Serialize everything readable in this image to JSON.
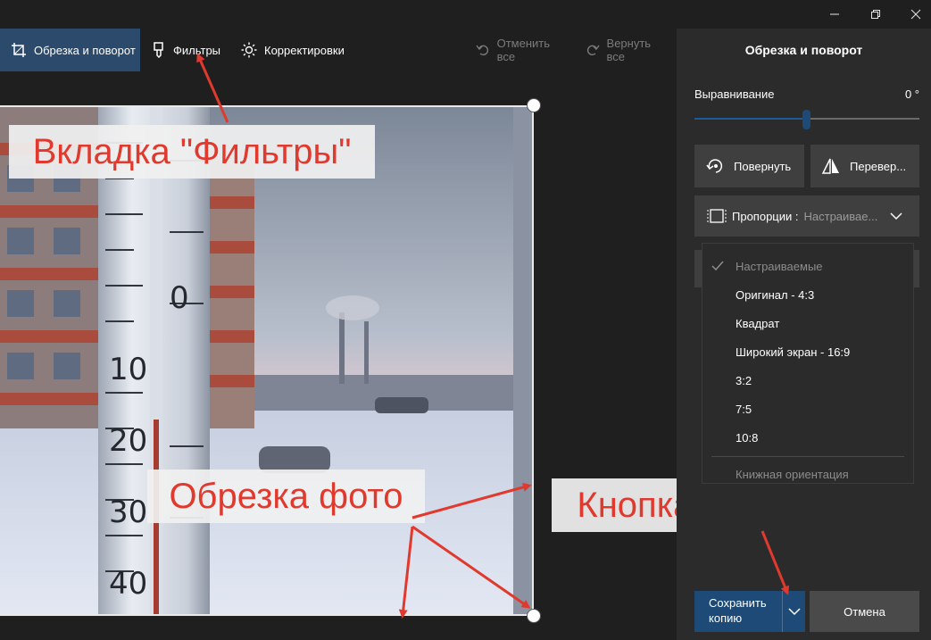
{
  "toolbar": {
    "crop_label": "Обрезка и поворот",
    "filters_label": "Фильтры",
    "adjust_label": "Корректировки",
    "undo_all_label": "Отменить все",
    "redo_all_label": "Вернуть все"
  },
  "window": {
    "minimize_icon": "minimize-icon",
    "restore_icon": "restore-icon",
    "close_icon": "close-icon"
  },
  "panel": {
    "title": "Обрезка и поворот",
    "straighten_label": "Выравнивание",
    "straighten_value": "0 °",
    "rotate_label": "Повернуть",
    "flip_label": "Перевер...",
    "aspect_label": "Пропорции :",
    "aspect_value": "Настраивае...",
    "aspect_options": [
      {
        "label": "Настраиваемые",
        "selected": true
      },
      {
        "label": "Оригинал - 4:3"
      },
      {
        "label": "Квадрат"
      },
      {
        "label": "Широкий экран - 16:9"
      },
      {
        "label": "3:2"
      },
      {
        "label": "7:5"
      },
      {
        "label": "10:8"
      }
    ],
    "orientation_label": "Книжная ориентация",
    "save_label": "Сохранить копию",
    "cancel_label": "Отмена"
  },
  "photo": {
    "thermometer_ticks": [
      "10",
      "20",
      "30",
      "40"
    ],
    "thermometer_zero": "0"
  },
  "annotations": {
    "filters_tab": "Вкладка \"Фильтры\"",
    "crop_photo": "Обрезка фото",
    "save_button": "Кнопка \"Сохранить\""
  },
  "colors": {
    "accent": "#1e4a78",
    "annotation_red": "#e03a2f",
    "active_tab": "#2c4a6b"
  }
}
